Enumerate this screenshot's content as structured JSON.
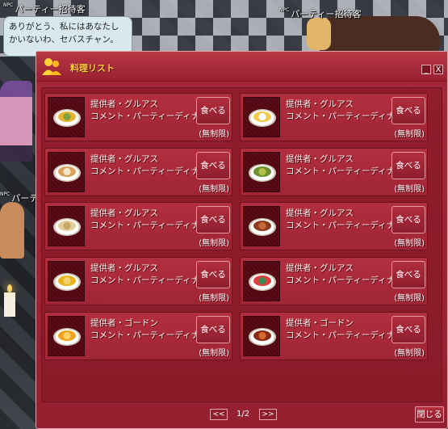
{
  "scene": {
    "npc_label_1": "パーティー招待客",
    "npc_label_2": "パーティー招待客",
    "npc_label_3": "パーティ",
    "npc_tag": "NPC",
    "bubble_text": "ありがとう、私にはあなたしかいないわ、セバスチャン。"
  },
  "window": {
    "title": "料理リスト",
    "minimize_label": "_",
    "close_x_label": "X",
    "pager_prev": "<<",
    "pager_text": "1/2",
    "pager_next": ">>",
    "close_button": "閉じる",
    "colors": {
      "title": "#ffd23a",
      "panel": "#95202f"
    }
  },
  "items": [
    {
      "provider": "提供者・グルアス",
      "comment": "コメント・パーティーディナー",
      "eat": "食べる",
      "limit": "(無制限)",
      "food_icon": "cocktail-icon"
    },
    {
      "provider": "提供者・グルアス",
      "comment": "コメント・パーティーディナー",
      "eat": "食べる",
      "limit": "(無制限)",
      "food_icon": "fried-egg-icon"
    },
    {
      "provider": "提供者・グルアス",
      "comment": "コメント・パーティーディナー",
      "eat": "食べる",
      "limit": "(無制限)",
      "food_icon": "cake-icon"
    },
    {
      "provider": "提供者・グルアス",
      "comment": "コメント・パーティーディナー",
      "eat": "食べる",
      "limit": "(無制限)",
      "food_icon": "salad-icon"
    },
    {
      "provider": "提供者・グルアス",
      "comment": "コメント・パーティーディナー",
      "eat": "食べる",
      "limit": "(無制限)",
      "food_icon": "pasta-icon"
    },
    {
      "provider": "提供者・グルアス",
      "comment": "コメント・パーティーディナー",
      "eat": "食べる",
      "limit": "(無制限)",
      "food_icon": "steak-icon"
    },
    {
      "provider": "提供者・グルアス",
      "comment": "コメント・パーティーディナー",
      "eat": "食べる",
      "limit": "(無制限)",
      "food_icon": "curry-icon"
    },
    {
      "provider": "提供者・グルアス",
      "comment": "コメント・パーティーディナー",
      "eat": "食べる",
      "limit": "(無制限)",
      "food_icon": "sushi-icon"
    },
    {
      "provider": "提供者・ゴードン",
      "comment": "コメント・パーティーディナー",
      "eat": "食べる",
      "limit": "(無制限)",
      "food_icon": "omelette-icon"
    },
    {
      "provider": "提供者・ゴードン",
      "comment": "コメント・パーティーディナー",
      "eat": "食べる",
      "limit": "(無制限)",
      "food_icon": "meat-dish-icon"
    }
  ]
}
